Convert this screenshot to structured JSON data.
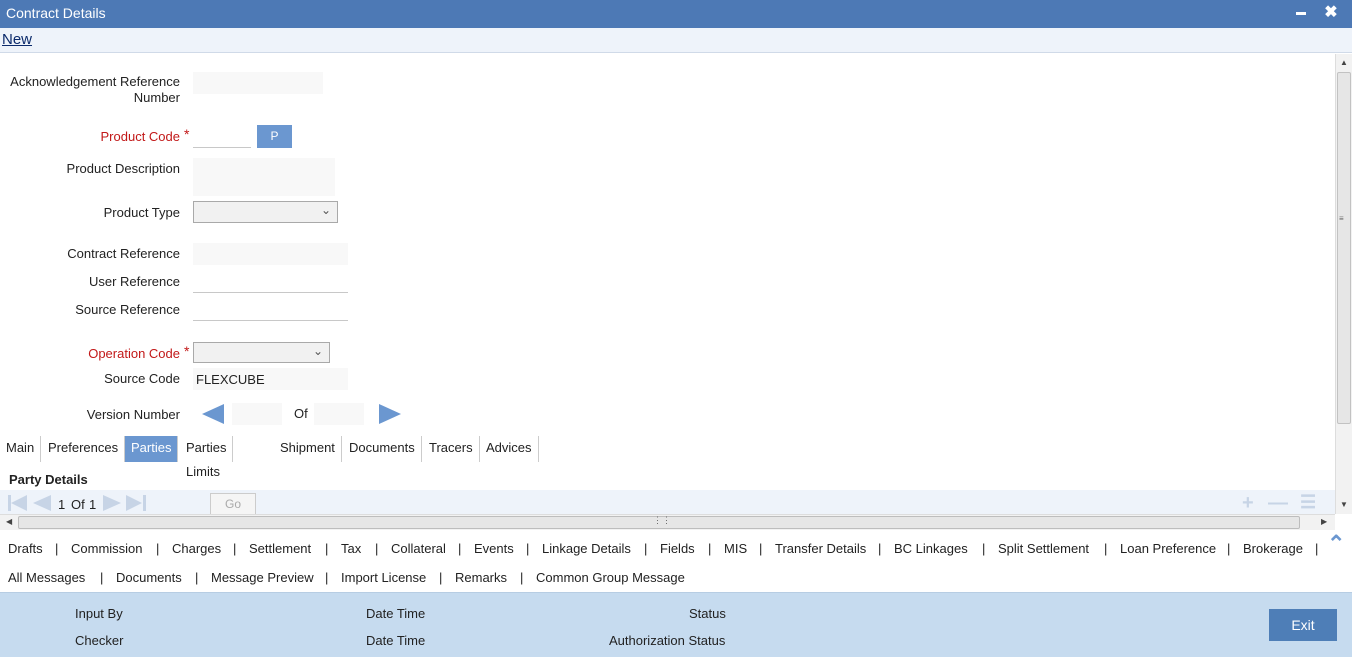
{
  "window": {
    "title": "Contract Details",
    "minimize": "▬",
    "close": "✖"
  },
  "menu": {
    "new_label": "New"
  },
  "form": {
    "ack_ref_label": "Acknowledgement Reference Number",
    "ack_ref_value": "",
    "product_code_label": "Product Code",
    "product_code_value": "",
    "p_button": "P",
    "product_desc_label": "Product Description",
    "product_desc_value": "",
    "product_type_label": "Product Type",
    "product_type_value": "",
    "contract_ref_label": "Contract Reference",
    "contract_ref_value": "",
    "user_ref_label": "User Reference",
    "user_ref_value": "",
    "source_ref_label": "Source Reference",
    "source_ref_value": "",
    "operation_code_label": "Operation Code",
    "operation_code_value": "",
    "source_code_label": "Source Code",
    "source_code_value": "FLEXCUBE",
    "version_label": "Version Number",
    "version_value": "",
    "of_label": "Of",
    "of_value": "",
    "required_mark": "*"
  },
  "tabs": [
    "Main",
    "Preferences",
    "Parties",
    "Parties Limits",
    "Shipment",
    "Documents",
    "Tracers",
    "Advices"
  ],
  "active_tab": "Parties",
  "party": {
    "title": "Party Details",
    "page_current": "1",
    "of_label": "Of",
    "page_total": "1",
    "go_label": "Go"
  },
  "links_row1": [
    "Drafts",
    "Commission",
    "Charges",
    "Settlement",
    "Tax",
    "Collateral",
    "Events",
    "Linkage Details",
    "Fields",
    "MIS",
    "Transfer Details",
    "BC Linkages",
    "Split Settlement",
    "Loan Preference",
    "Brokerage"
  ],
  "links_row2": [
    "All Messages",
    "Documents",
    "Message Preview",
    "Import License",
    "Remarks",
    "Common Group Message"
  ],
  "footer": {
    "input_by": "Input By",
    "checker": "Checker",
    "date_time_1": "Date Time",
    "date_time_2": "Date Time",
    "status": "Status",
    "auth_status": "Authorization Status",
    "exit_label": "Exit"
  },
  "colors": {
    "titlebar": "#4d79b5",
    "accent": "#6b97d0",
    "required": "#c21818",
    "footer": "#c6dbef"
  }
}
